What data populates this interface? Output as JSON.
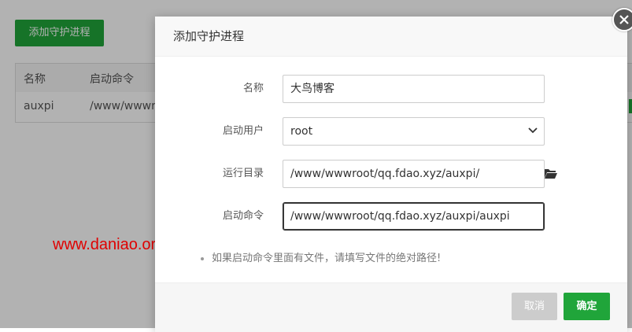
{
  "background": {
    "add_button": "添加守护进程",
    "table": {
      "headers": [
        "名称",
        "启动命令"
      ],
      "rows": [
        [
          "auxpi",
          "/www/wwwr"
        ]
      ]
    }
  },
  "modal": {
    "title": "添加守护进程",
    "fields": {
      "name": {
        "label": "名称",
        "value": "大鸟博客"
      },
      "user": {
        "label": "启动用户",
        "value": "root"
      },
      "dir": {
        "label": "运行目录",
        "value": "/www/wwwroot/qq.fdao.xyz/auxpi/"
      },
      "cmd": {
        "label": "启动命令",
        "value": "/www/wwwroot/qq.fdao.xyz/auxpi/auxpi"
      }
    },
    "hint": "如果启动命令里面有文件，请填写文件的绝对路径!",
    "cancel_label": "取消",
    "confirm_label": "确定"
  },
  "watermark": "www.daniao.org",
  "colors": {
    "accent": "#20a53a",
    "watermark": "#e00000"
  },
  "icons": {
    "close": "close-icon",
    "select": "chevron-down-icon",
    "folder": "folder-open-icon"
  }
}
